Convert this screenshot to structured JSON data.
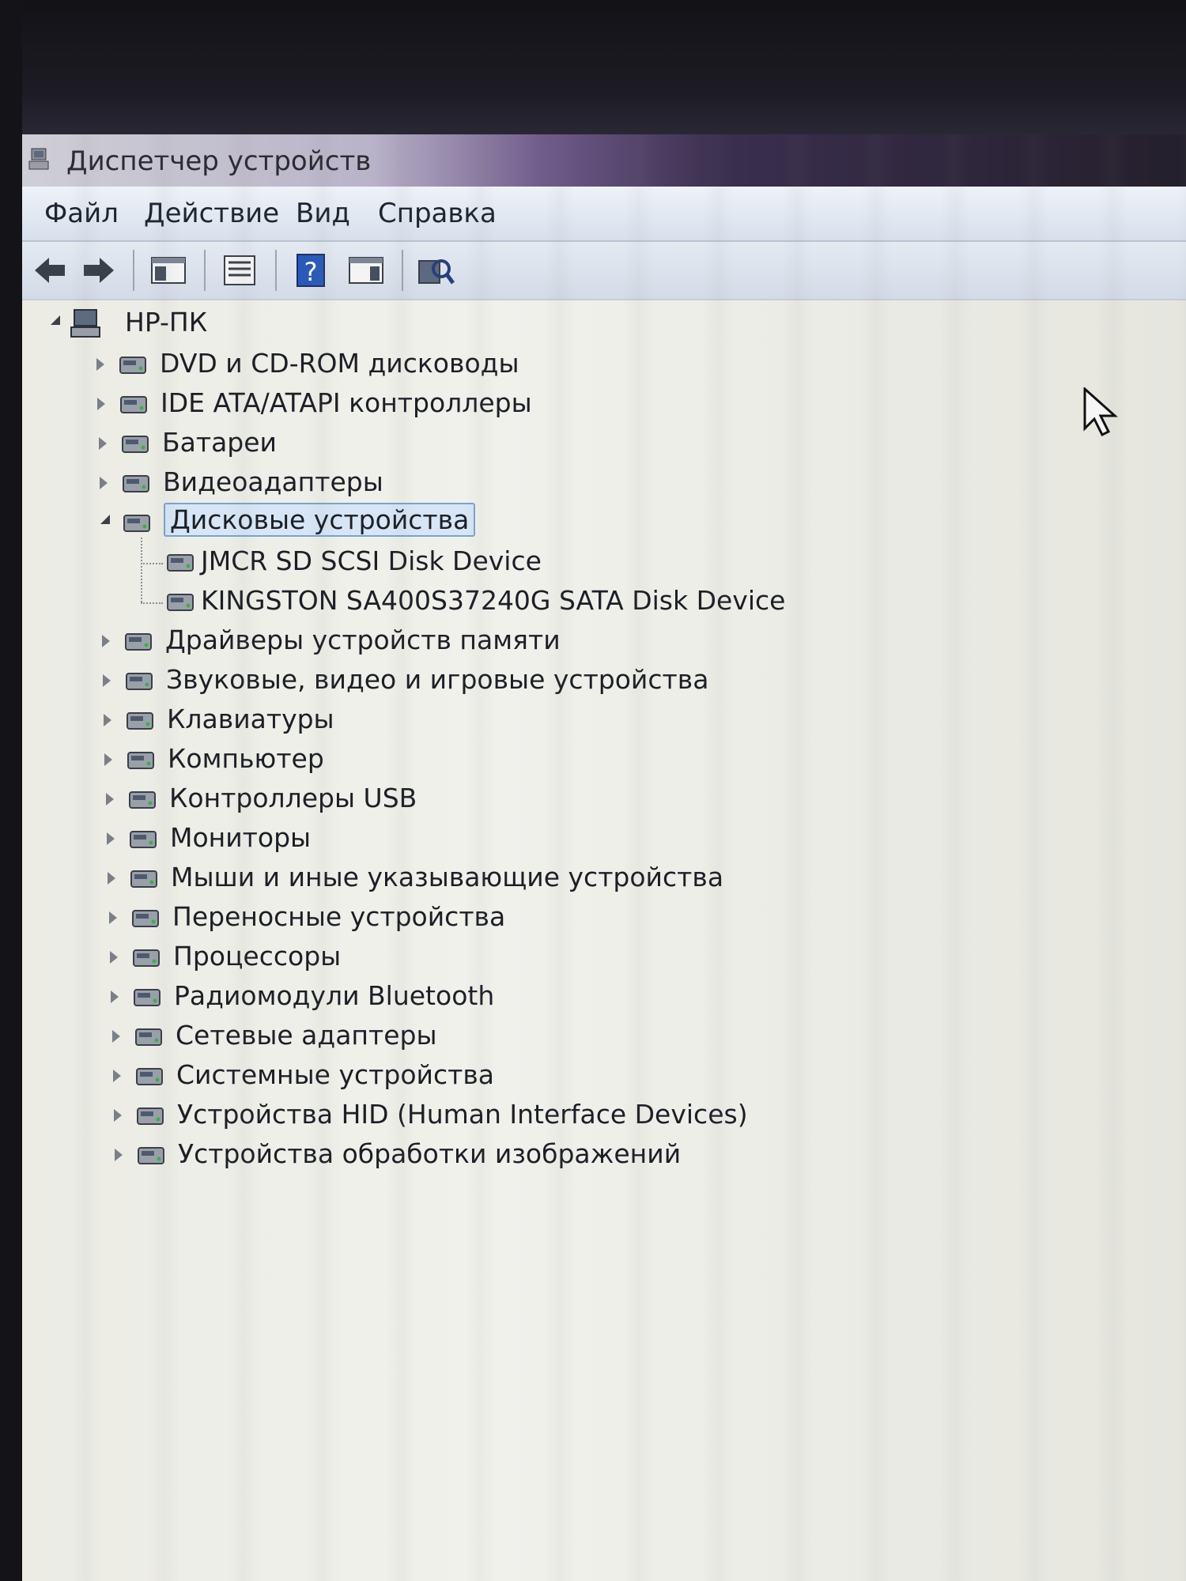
{
  "window": {
    "title": "Диспетчер устройств"
  },
  "menu": {
    "items": [
      "Файл",
      "Действие",
      "Вид",
      "Справка"
    ]
  },
  "toolbar": {
    "buttons": [
      "back-icon",
      "forward-icon",
      "console-tree-icon",
      "properties-icon",
      "help-icon",
      "action-pane-icon",
      "scan-hardware-icon"
    ]
  },
  "tree": {
    "root": "HP-ПК",
    "categories": [
      {
        "label": "DVD и CD-ROM дисководы",
        "icon": "dvd-drive-icon",
        "expanded": false
      },
      {
        "label": "IDE ATA/ATAPI контроллеры",
        "icon": "ide-controller-icon",
        "expanded": false
      },
      {
        "label": "Батареи",
        "icon": "battery-icon",
        "expanded": false
      },
      {
        "label": "Видеоадаптеры",
        "icon": "display-adapter-icon",
        "expanded": false
      },
      {
        "label": "Дисковые устройства",
        "icon": "disk-drive-icon",
        "expanded": true,
        "selected": true,
        "children": [
          "JMCR SD SCSI Disk Device",
          "KINGSTON  SA400S37240G SATA Disk Device"
        ]
      },
      {
        "label": "Драйверы устройств памяти",
        "icon": "memory-device-icon",
        "expanded": false
      },
      {
        "label": "Звуковые, видео и игровые устройства",
        "icon": "speaker-icon",
        "expanded": false
      },
      {
        "label": "Клавиатуры",
        "icon": "keyboard-icon",
        "expanded": false
      },
      {
        "label": "Компьютер",
        "icon": "computer-icon",
        "expanded": false
      },
      {
        "label": "Контроллеры USB",
        "icon": "usb-icon",
        "expanded": false
      },
      {
        "label": "Мониторы",
        "icon": "monitor-icon",
        "expanded": false
      },
      {
        "label": "Мыши и иные указывающие устройства",
        "icon": "mouse-icon",
        "expanded": false
      },
      {
        "label": "Переносные устройства",
        "icon": "portable-device-icon",
        "expanded": false
      },
      {
        "label": "Процессоры",
        "icon": "processor-icon",
        "expanded": false
      },
      {
        "label": "Радиомодули Bluetooth",
        "icon": "bluetooth-icon",
        "expanded": false
      },
      {
        "label": "Сетевые адаптеры",
        "icon": "network-adapter-icon",
        "expanded": false
      },
      {
        "label": "Системные устройства",
        "icon": "system-device-icon",
        "expanded": false
      },
      {
        "label": "Устройства HID (Human Interface Devices)",
        "icon": "hid-icon",
        "expanded": false
      },
      {
        "label": "Устройства обработки изображений",
        "icon": "imaging-device-icon",
        "expanded": false
      }
    ]
  },
  "colors": {
    "selection_border": "#7da2ce",
    "selection_fill": "#d7e6f6",
    "text": "#1c1f26"
  }
}
